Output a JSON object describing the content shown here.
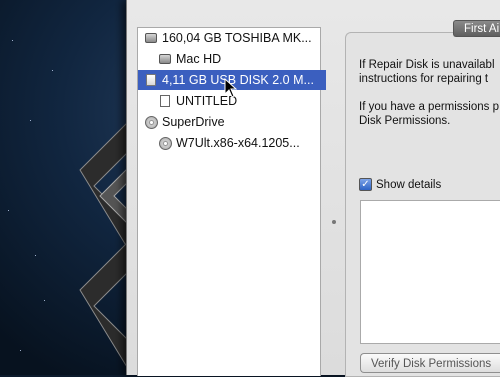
{
  "sidebar": {
    "items": [
      {
        "label": "160,04 GB TOSHIBA MK...",
        "icon": "hard-disk-icon"
      },
      {
        "label": "Mac HD",
        "icon": "volume-icon"
      },
      {
        "label": "4,11 GB USB DISK 2.0 M...",
        "icon": "usb-disk-icon",
        "selected": true
      },
      {
        "label": "UNTITLED",
        "icon": "volume-icon"
      },
      {
        "label": "SuperDrive",
        "icon": "optical-drive-icon"
      },
      {
        "label": "W7Ult.x86-x64.1205...",
        "icon": "disc-image-icon"
      }
    ]
  },
  "panel": {
    "tab_label": "First Ai",
    "info_line1": "If Repair Disk is unavailabl",
    "info_line2": "instructions for repairing t",
    "info_line3": "If you have a permissions p",
    "info_line4": "Disk Permissions.",
    "show_details_label": "Show details",
    "show_details_checked": true,
    "verify_button_label": "Verify Disk Permissions"
  },
  "colors": {
    "selection": "#3b5fbf",
    "checkbox": "#2e63c5"
  }
}
